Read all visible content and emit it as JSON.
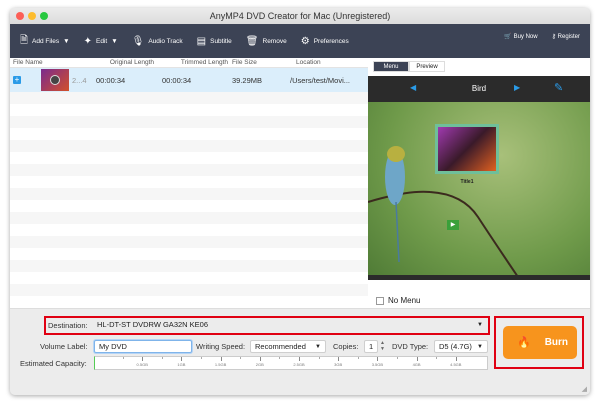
{
  "window": {
    "title": "AnyMP4 DVD Creator for Mac (Unregistered)"
  },
  "toolbar": {
    "add_files": "Add Files",
    "edit": "Edit",
    "audio_track": "Audio Track",
    "subtitle": "Subtitle",
    "remove": "Remove",
    "preferences": "Preferences",
    "buy_now": "Buy Now",
    "register": "Register"
  },
  "file_list": {
    "columns": [
      "File Name",
      "Original Length",
      "Trimmed Length",
      "File Size",
      "Location"
    ],
    "rows": [
      {
        "name": "2...4",
        "original_length": "00:00:34",
        "trimmed_length": "00:00:34",
        "file_size": "39.29MB",
        "location": "/Users/test/Movi..."
      }
    ]
  },
  "preview": {
    "tabs": [
      "Menu",
      "Preview"
    ],
    "active_tab": "Menu",
    "template_name": "Bird",
    "title_label": "Title1",
    "no_menu_label": "No Menu",
    "no_menu_checked": false
  },
  "bottom": {
    "destination_label": "Destination:",
    "destination_value": "HL-DT-ST DVDRW  GA32N KE06",
    "volume_label": "Volume Label:",
    "volume_value": "My DVD",
    "writing_speed_label": "Writing Speed:",
    "writing_speed_value": "Recommended",
    "copies_label": "Copies:",
    "copies_value": "1",
    "dvd_type_label": "DVD Type:",
    "dvd_type_value": "D5 (4.7G)",
    "capacity_label": "Estimated Capacity:",
    "capacity_ticks": [
      "0.5GB",
      "1GB",
      "1.5GB",
      "2GB",
      "2.5GB",
      "3GB",
      "3.5GB",
      "4GB",
      "4.5GB"
    ],
    "burn_label": "Burn"
  },
  "colors": {
    "toolbar": "#3c4355",
    "burn": "#f7941d",
    "highlight": "#e00012",
    "selected_row": "#dbeefb"
  }
}
